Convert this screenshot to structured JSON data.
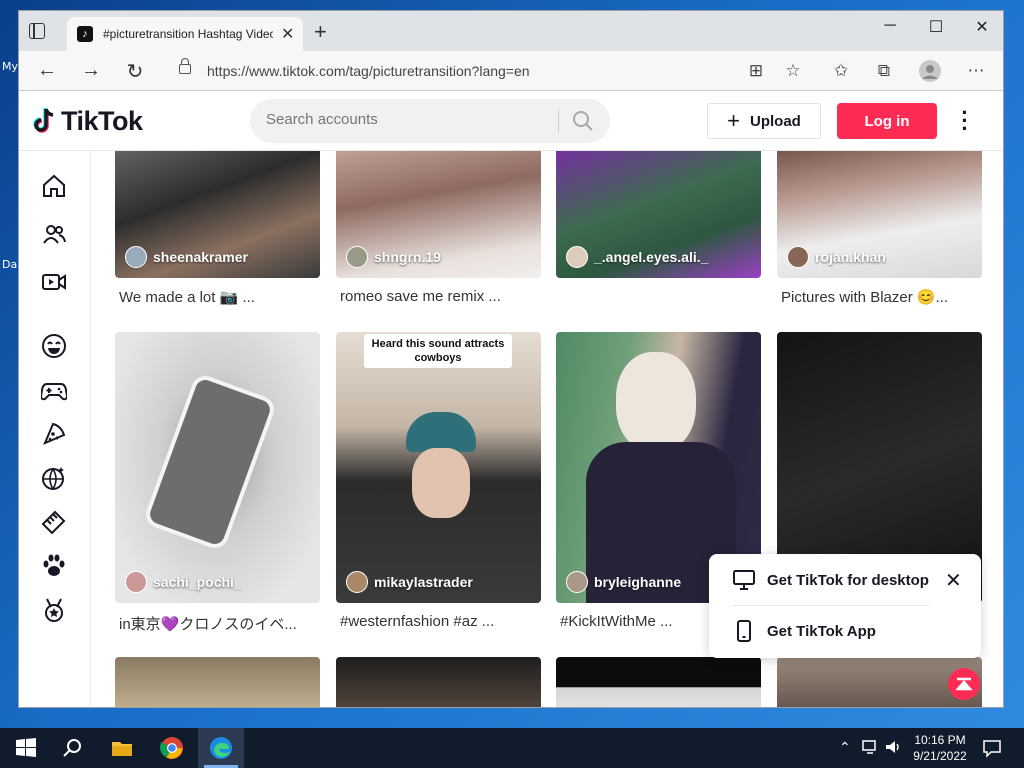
{
  "desktop": {
    "labels": [
      "My",
      "Da"
    ]
  },
  "browser": {
    "tab_title": "#picturetransition Hashtag Videos",
    "url": "https://www.tiktok.com/tag/picturetransition?lang=en"
  },
  "tiktok": {
    "logo_text": "TikTok",
    "search_placeholder": "Search accounts",
    "upload_label": "Upload",
    "login_label": "Log in"
  },
  "sidebar": {
    "items": [
      "home-icon",
      "following-icon",
      "live-icon",
      "comedy-icon",
      "gaming-icon",
      "food-icon",
      "sports-icon",
      "beauty-icon",
      "animals-icon",
      "achievement-icon"
    ]
  },
  "videos": [
    {
      "user": "sheenakramer",
      "caption": "We made a lot 📷 ..."
    },
    {
      "user": "shngrn.19",
      "caption": "romeo save me remix ..."
    },
    {
      "user": "_.angel.eyes.ali._",
      "caption": ""
    },
    {
      "user": "rojan.khan",
      "caption": "Pictures with Blazer 😊..."
    },
    {
      "user": "sachi_pochi_",
      "caption": "in東京💜クロノスのイベ..."
    },
    {
      "user": "mikaylastrader",
      "caption": "#westernfashion #az ...",
      "overlay": "Heard this sound attracts cowboys"
    },
    {
      "user": "bryleighanne",
      "caption": "#KickItWithMe ..."
    },
    {
      "user": "",
      "caption": ""
    }
  ],
  "popup": {
    "desktop_label": "Get TikTok for desktop",
    "app_label": "Get TikTok App"
  },
  "taskbar": {
    "time": "10:16 PM",
    "date": "9/21/2022"
  }
}
